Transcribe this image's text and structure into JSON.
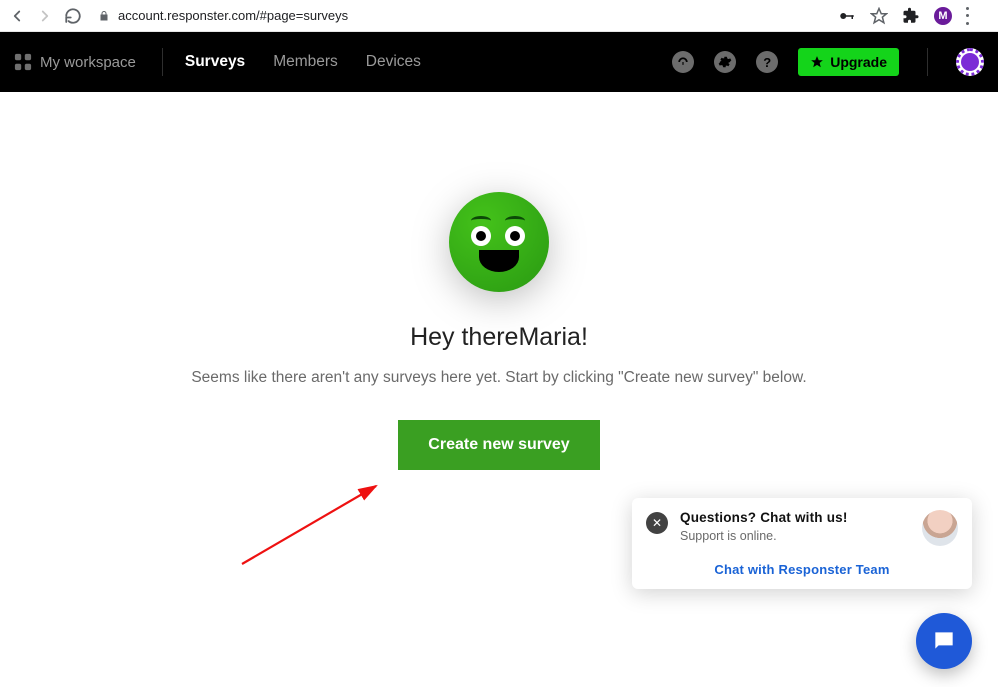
{
  "browser": {
    "url": "account.responster.com/#page=surveys",
    "profile_initial": "M"
  },
  "nav": {
    "workspace_label": "My workspace",
    "items": [
      "Surveys",
      "Members",
      "Devices"
    ],
    "active_index": 0,
    "upgrade_label": "Upgrade"
  },
  "empty_state": {
    "greeting": "Hey thereMaria!",
    "subtext": "Seems like there aren't any surveys here yet. Start by clicking \"Create new survey\" below.",
    "cta_label": "Create new survey"
  },
  "chat": {
    "title": "Questions? Chat with us!",
    "status": "Support is online.",
    "link": "Chat with Responster Team"
  }
}
